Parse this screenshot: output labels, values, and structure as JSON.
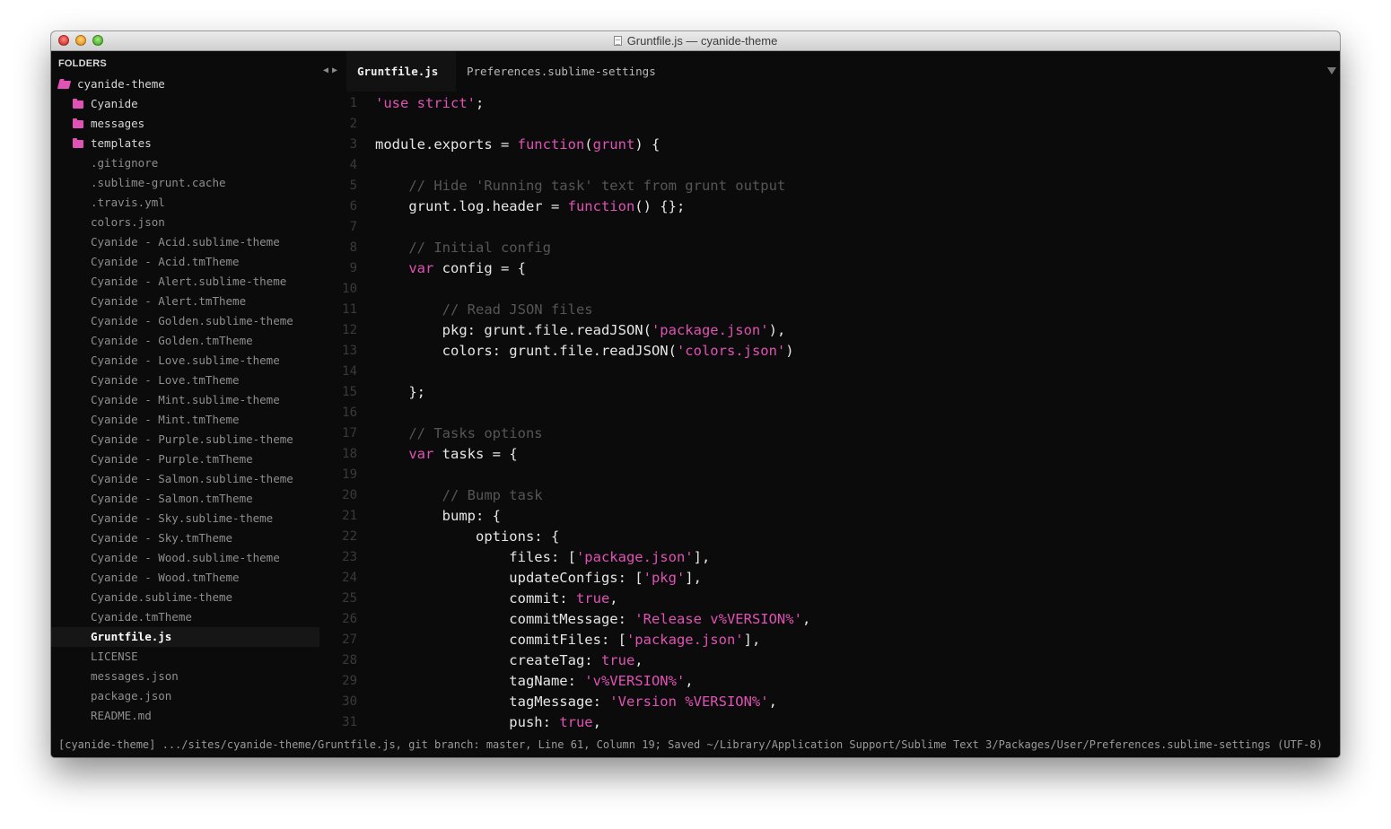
{
  "window": {
    "title": "Gruntfile.js — cyanide-theme",
    "traffic_lights": [
      "close",
      "minimize",
      "zoom"
    ]
  },
  "colors": {
    "accent": "#e052b4",
    "background": "#0b0b0b",
    "comment": "#555555",
    "text": "#e6e6e6"
  },
  "sidebar": {
    "header": "FOLDERS",
    "root": "cyanide-theme",
    "folders": [
      "Cyanide",
      "messages",
      "templates"
    ],
    "files": [
      ".gitignore",
      ".sublime-grunt.cache",
      ".travis.yml",
      "colors.json",
      "Cyanide - Acid.sublime-theme",
      "Cyanide - Acid.tmTheme",
      "Cyanide - Alert.sublime-theme",
      "Cyanide - Alert.tmTheme",
      "Cyanide - Golden.sublime-theme",
      "Cyanide - Golden.tmTheme",
      "Cyanide - Love.sublime-theme",
      "Cyanide - Love.tmTheme",
      "Cyanide - Mint.sublime-theme",
      "Cyanide - Mint.tmTheme",
      "Cyanide - Purple.sublime-theme",
      "Cyanide - Purple.tmTheme",
      "Cyanide - Salmon.sublime-theme",
      "Cyanide - Salmon.tmTheme",
      "Cyanide - Sky.sublime-theme",
      "Cyanide - Sky.tmTheme",
      "Cyanide - Wood.sublime-theme",
      "Cyanide - Wood.tmTheme",
      "Cyanide.sublime-theme",
      "Cyanide.tmTheme",
      "Gruntfile.js",
      "LICENSE",
      "messages.json",
      "package.json",
      "README.md"
    ],
    "active_file": "Gruntfile.js"
  },
  "tabs": [
    {
      "label": "Gruntfile.js",
      "active": true,
      "dirty": true
    },
    {
      "label": "Preferences.sublime-settings",
      "active": false,
      "dirty": false
    }
  ],
  "editor": {
    "lines": [
      {
        "n": "1",
        "tokens": [
          [
            "s",
            "'use strict'"
          ],
          [
            "p",
            ";"
          ]
        ]
      },
      {
        "n": "2",
        "tokens": []
      },
      {
        "n": "3",
        "tokens": [
          [
            "p",
            "module.exports = "
          ],
          [
            "k",
            "function"
          ],
          [
            "p",
            "("
          ],
          [
            "s",
            "grunt"
          ],
          [
            "p",
            ") {"
          ]
        ]
      },
      {
        "n": "4",
        "tokens": []
      },
      {
        "n": "5",
        "tokens": [
          [
            "p",
            "    "
          ],
          [
            "c",
            "// Hide 'Running task' text from grunt output"
          ]
        ]
      },
      {
        "n": "6",
        "tokens": [
          [
            "p",
            "    grunt.log.header = "
          ],
          [
            "k",
            "function"
          ],
          [
            "p",
            "() {};"
          ]
        ]
      },
      {
        "n": "7",
        "tokens": []
      },
      {
        "n": "8",
        "tokens": [
          [
            "p",
            "    "
          ],
          [
            "c",
            "// Initial config"
          ]
        ]
      },
      {
        "n": "9",
        "tokens": [
          [
            "p",
            "    "
          ],
          [
            "k",
            "var"
          ],
          [
            "p",
            " config = {"
          ]
        ]
      },
      {
        "n": "10",
        "tokens": []
      },
      {
        "n": "11",
        "tokens": [
          [
            "p",
            "        "
          ],
          [
            "c",
            "// Read JSON files"
          ]
        ]
      },
      {
        "n": "12",
        "tokens": [
          [
            "p",
            "        pkg: grunt.file.readJSON("
          ],
          [
            "s",
            "'package.json'"
          ],
          [
            "p",
            "),"
          ]
        ]
      },
      {
        "n": "13",
        "tokens": [
          [
            "p",
            "        colors: grunt.file.readJSON("
          ],
          [
            "s",
            "'colors.json'"
          ],
          [
            "p",
            ")"
          ]
        ]
      },
      {
        "n": "14",
        "tokens": []
      },
      {
        "n": "15",
        "tokens": [
          [
            "p",
            "    };"
          ]
        ]
      },
      {
        "n": "16",
        "tokens": []
      },
      {
        "n": "17",
        "tokens": [
          [
            "p",
            "    "
          ],
          [
            "c",
            "// Tasks options"
          ]
        ]
      },
      {
        "n": "18",
        "tokens": [
          [
            "p",
            "    "
          ],
          [
            "k",
            "var"
          ],
          [
            "p",
            " tasks = {"
          ]
        ]
      },
      {
        "n": "19",
        "tokens": []
      },
      {
        "n": "20",
        "tokens": [
          [
            "p",
            "        "
          ],
          [
            "c",
            "// Bump task"
          ]
        ]
      },
      {
        "n": "21",
        "tokens": [
          [
            "p",
            "        bump: {"
          ]
        ]
      },
      {
        "n": "22",
        "tokens": [
          [
            "p",
            "            options: {"
          ]
        ]
      },
      {
        "n": "23",
        "tokens": [
          [
            "p",
            "                files: ["
          ],
          [
            "s",
            "'package.json'"
          ],
          [
            "p",
            "],"
          ]
        ]
      },
      {
        "n": "24",
        "tokens": [
          [
            "p",
            "                updateConfigs: ["
          ],
          [
            "s",
            "'pkg'"
          ],
          [
            "p",
            "],"
          ]
        ]
      },
      {
        "n": "25",
        "tokens": [
          [
            "p",
            "                commit: "
          ],
          [
            "k",
            "true"
          ],
          [
            "p",
            ","
          ]
        ]
      },
      {
        "n": "26",
        "tokens": [
          [
            "p",
            "                commitMessage: "
          ],
          [
            "s",
            "'Release v%VERSION%'"
          ],
          [
            "p",
            ","
          ]
        ]
      },
      {
        "n": "27",
        "tokens": [
          [
            "p",
            "                commitFiles: ["
          ],
          [
            "s",
            "'package.json'"
          ],
          [
            "p",
            "],"
          ]
        ]
      },
      {
        "n": "28",
        "tokens": [
          [
            "p",
            "                createTag: "
          ],
          [
            "k",
            "true"
          ],
          [
            "p",
            ","
          ]
        ]
      },
      {
        "n": "29",
        "tokens": [
          [
            "p",
            "                tagName: "
          ],
          [
            "s",
            "'v%VERSION%'"
          ],
          [
            "p",
            ","
          ]
        ]
      },
      {
        "n": "30",
        "tokens": [
          [
            "p",
            "                tagMessage: "
          ],
          [
            "s",
            "'Version %VERSION%'"
          ],
          [
            "p",
            ","
          ]
        ]
      },
      {
        "n": "31",
        "tokens": [
          [
            "p",
            "                push: "
          ],
          [
            "k",
            "true"
          ],
          [
            "p",
            ","
          ]
        ]
      }
    ]
  },
  "status": {
    "text": "[cyanide-theme] .../sites/cyanide-theme/Gruntfile.js, git branch: master, Line 61, Column 19; Saved ~/Library/Application Support/Sublime Text 3/Packages/User/Preferences.sublime-settings (UTF-8)"
  }
}
